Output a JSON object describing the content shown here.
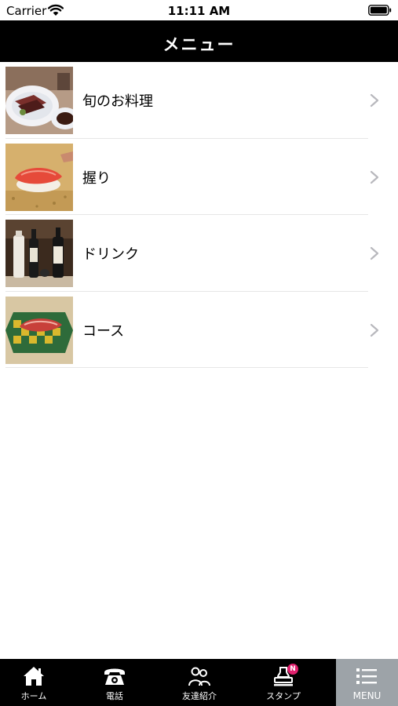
{
  "status_bar": {
    "carrier": "Carrier",
    "time": "11:11 AM"
  },
  "nav": {
    "title": "メニュー"
  },
  "menu": {
    "items": [
      {
        "label": "旬のお料理",
        "thumb": "seasonal-dish-photo"
      },
      {
        "label": "握り",
        "thumb": "nigiri-photo"
      },
      {
        "label": "ドリンク",
        "thumb": "drink-bottles-photo"
      },
      {
        "label": "コース",
        "thumb": "course-dish-photo"
      }
    ]
  },
  "tabbar": {
    "tabs": [
      {
        "label": "ホーム",
        "icon": "home-icon"
      },
      {
        "label": "電話",
        "icon": "phone-icon"
      },
      {
        "label": "友達紹介",
        "icon": "friends-icon"
      },
      {
        "label": "スタンプ",
        "icon": "stamp-icon",
        "badge": "N"
      },
      {
        "label": "MENU",
        "icon": "menu-list-icon",
        "active": true
      }
    ]
  },
  "colors": {
    "navbar_bg": "#000000",
    "tabbar_bg": "#000000",
    "tab_active_bg": "#9da3a8",
    "badge": "#e0206d"
  }
}
